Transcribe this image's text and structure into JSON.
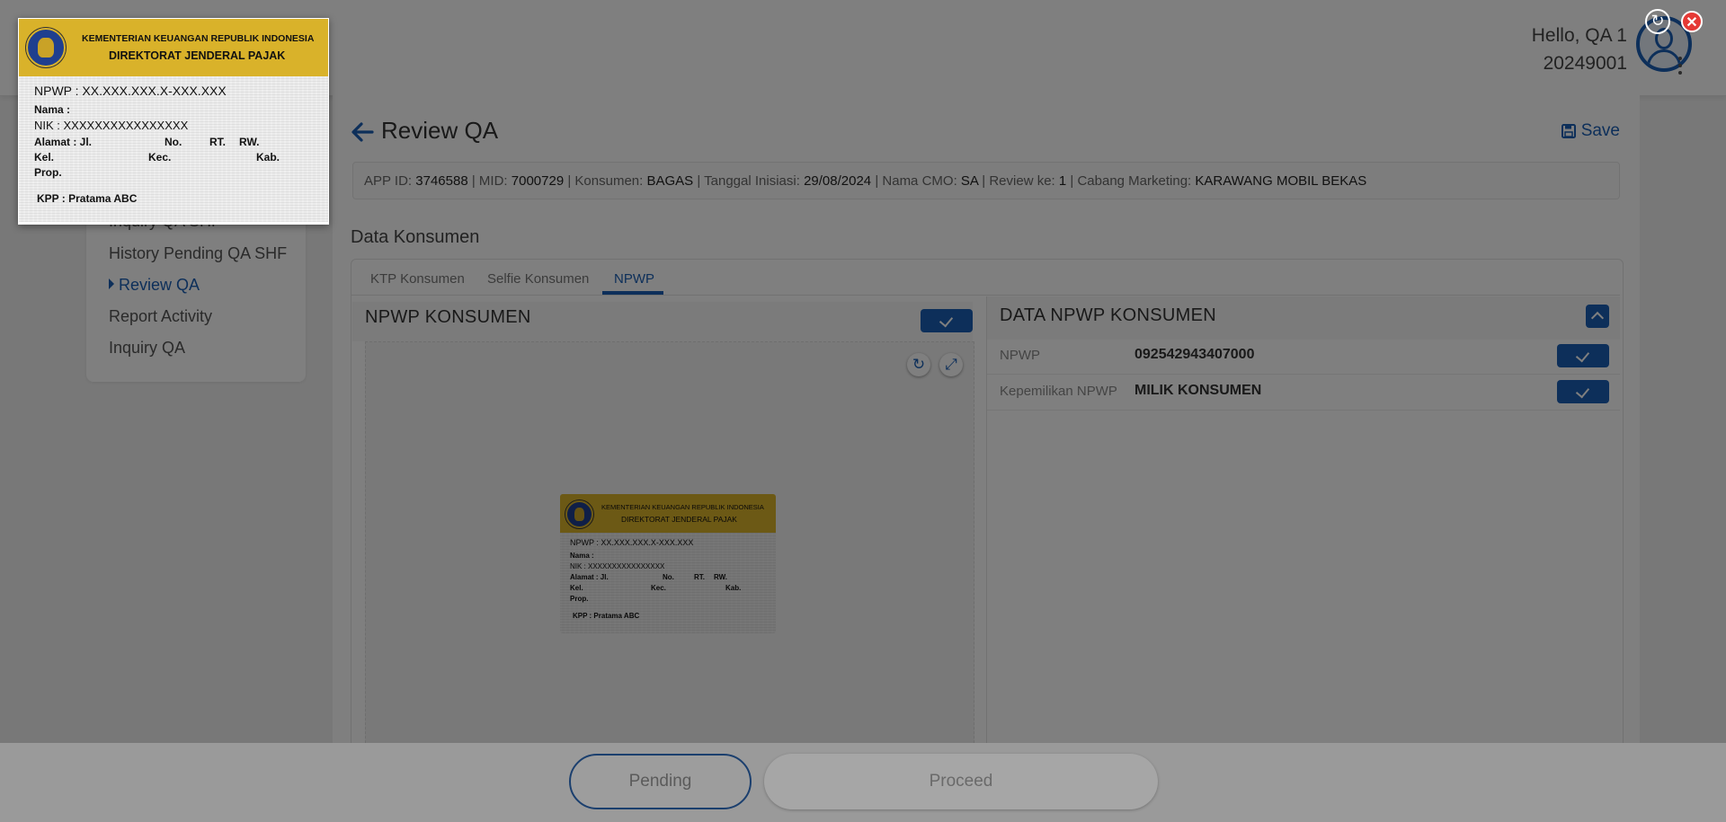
{
  "header": {
    "greeting": "Hello, QA 1",
    "user_id": "20249001"
  },
  "sidebar": {
    "items": [
      {
        "label": "Inquiry QA SHF",
        "active": false
      },
      {
        "label": "History Pending QA SHF",
        "active": false
      },
      {
        "label": "Review QA",
        "active": true
      },
      {
        "label": "Report Activity",
        "active": false
      },
      {
        "label": "Inquiry QA",
        "active": false
      }
    ]
  },
  "page": {
    "title": "Review QA",
    "save_label": "Save"
  },
  "info": {
    "app_id_label": "APP ID:",
    "app_id": "3746588",
    "mid_label": "MID:",
    "mid": "7000729",
    "konsumen_label": "Konsumen:",
    "konsumen": "BAGAS",
    "tanggal_label": "Tanggal Inisiasi:",
    "tanggal": "29/08/2024",
    "cmo_label": "Nama CMO:",
    "cmo": "SA",
    "review_label": "Review ke:",
    "review": "1",
    "cabang_label": "Cabang Marketing:",
    "cabang": "KARAWANG MOBIL BEKAS",
    "sep": "|"
  },
  "section": {
    "title": "Data Konsumen"
  },
  "tabs": [
    {
      "label": "KTP Konsumen",
      "active": false
    },
    {
      "label": "Selfie Konsumen",
      "active": false
    },
    {
      "label": "NPWP",
      "active": true
    }
  ],
  "left_panel": {
    "title": "NPWP KONSUMEN"
  },
  "right_panel": {
    "title": "DATA NPWP KONSUMEN",
    "rows": [
      {
        "label": "NPWP",
        "value": "092542943407000"
      },
      {
        "label": "Kepemilikan NPWP",
        "value": "MILIK KONSUMEN"
      }
    ]
  },
  "npwp_card": {
    "line1": "KEMENTERIAN KEUANGAN REPUBLIK INDONESIA",
    "line2": "DIREKTORAT JENDERAL PAJAK",
    "npwp": "NPWP :  XX.XXX.XXX.X-XXX.XXX",
    "nama": "Nama :",
    "nik": "NIK    : XXXXXXXXXXXXXXXX",
    "alamat": "Alamat : Jl.",
    "no": "No.",
    "rt": "RT.",
    "rw": "RW.",
    "kel": "Kel.",
    "kec": "Kec.",
    "kab": "Kab.",
    "prop": "Prop.",
    "kpp": "KPP   : Pratama ABC"
  },
  "footer": {
    "pending_label": "Pending",
    "proceed_label": "Proceed"
  },
  "icons": {
    "rotate": "↻",
    "close": "✕",
    "fullscreen": "⤢"
  },
  "colors": {
    "accent": "#1b5fb4",
    "close_red": "#e53935",
    "npwp_gold": "#d9b22a"
  }
}
